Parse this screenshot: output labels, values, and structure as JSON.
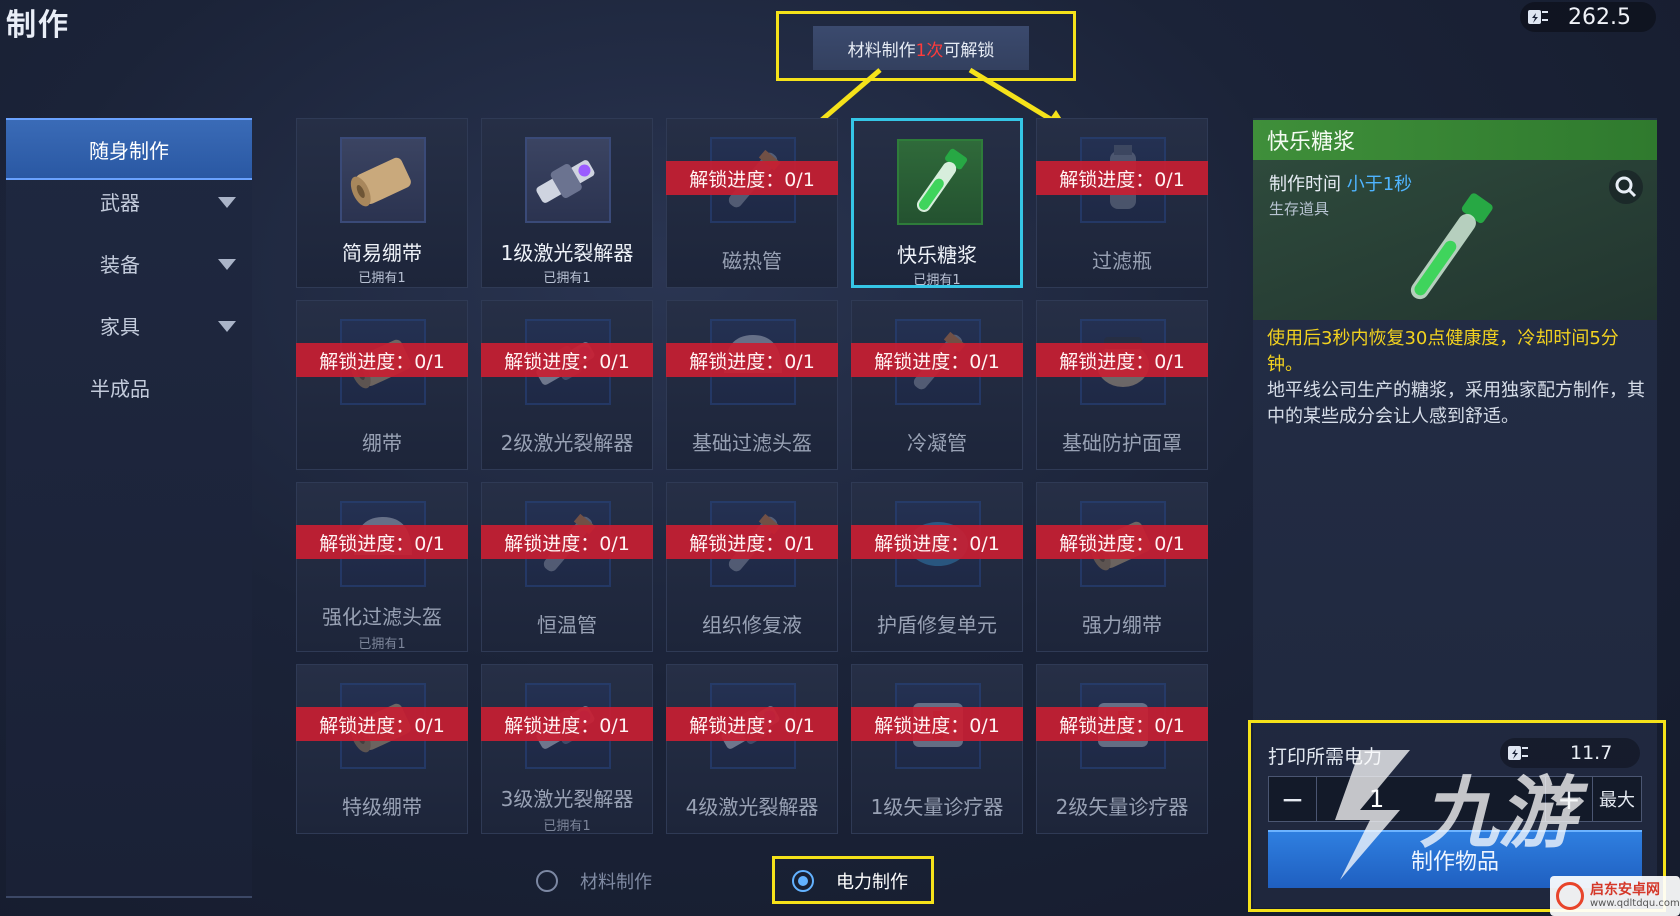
{
  "title": "制作",
  "top_power": {
    "value": "262.5",
    "icon": "power-plug-icon"
  },
  "hint": {
    "pre": "材料制作",
    "count": "1次",
    "post": "可解锁"
  },
  "sidebar": {
    "items": [
      {
        "label": "随身制作",
        "active": true
      },
      {
        "label": "武器",
        "dropdown": true
      },
      {
        "label": "装备",
        "dropdown": true
      },
      {
        "label": "家具",
        "dropdown": true
      },
      {
        "label": "半成品"
      }
    ]
  },
  "grid": {
    "items": [
      {
        "name": "简易绷带",
        "owned": "已拥有1",
        "locked": false,
        "art": "bandage"
      },
      {
        "name": "1级激光裂解器",
        "owned": "已拥有1",
        "locked": false,
        "art": "laser"
      },
      {
        "name": "磁热管",
        "progress": "解锁进度：0/1",
        "locked": true,
        "art": "tube"
      },
      {
        "name": "快乐糖浆",
        "owned": "已拥有1",
        "locked": false,
        "selected": true,
        "art": "syrup"
      },
      {
        "name": "过滤瓶",
        "progress": "解锁进度：0/1",
        "locked": true,
        "art": "bottle"
      },
      {
        "name": "绷带",
        "progress": "解锁进度：0/1",
        "locked": true,
        "art": "bandage"
      },
      {
        "name": "2级激光裂解器",
        "progress": "解锁进度：0/1",
        "locked": true,
        "art": "laser"
      },
      {
        "name": "基础过滤头盔",
        "progress": "解锁进度：0/1",
        "locked": true,
        "art": "helmet"
      },
      {
        "name": "冷凝管",
        "progress": "解锁进度：0/1",
        "locked": true,
        "art": "tube"
      },
      {
        "name": "基础防护面罩",
        "progress": "解锁进度：0/1",
        "locked": true,
        "art": "mask"
      },
      {
        "name": "强化过滤头盔",
        "progress": "解锁进度：0/1",
        "owned": "已拥有1",
        "locked": true,
        "art": "helmet"
      },
      {
        "name": "恒温管",
        "progress": "解锁进度：0/1",
        "locked": true,
        "art": "tube"
      },
      {
        "name": "组织修复液",
        "progress": "解锁进度：0/1",
        "locked": true,
        "art": "tube"
      },
      {
        "name": "护盾修复单元",
        "progress": "解锁进度：0/1",
        "locked": true,
        "art": "shield"
      },
      {
        "name": "强力绷带",
        "progress": "解锁进度：0/1",
        "locked": true,
        "art": "bandage"
      },
      {
        "name": "特级绷带",
        "progress": "解锁进度：0/1",
        "locked": true,
        "art": "bandage"
      },
      {
        "name": "3级激光裂解器",
        "progress": "解锁进度：0/1",
        "owned": "已拥有1",
        "locked": true,
        "art": "laser"
      },
      {
        "name": "4级激光裂解器",
        "progress": "解锁进度：0/1",
        "locked": true,
        "art": "laser"
      },
      {
        "name": "1级矢量诊疗器",
        "progress": "解锁进度：0/1",
        "locked": true,
        "art": "medkit"
      },
      {
        "name": "2级矢量诊疗器",
        "progress": "解锁进度：0/1",
        "locked": true,
        "art": "medkit"
      }
    ]
  },
  "detail": {
    "name": "快乐糖浆",
    "time_label": "制作时间",
    "time_value": "小于1秒",
    "category": "生存道具",
    "effect": "使用后3秒内恢复30点健康度，冷却时间5分钟。",
    "lore": "地平线公司生产的糖浆，采用独家配方制作，其中的某些成分会让人感到舒适。"
  },
  "craft": {
    "power_label": "打印所需电力",
    "power_value": "11.7",
    "minus": "−",
    "quantity": "1",
    "plus": "+",
    "max": "最大",
    "button": "制作物品"
  },
  "modes": {
    "material": "材料制作",
    "power": "电力制作"
  },
  "watermark": {
    "brand": "九游",
    "site_title": "启东安卓网",
    "site_url": "www.qdltdqu.com"
  },
  "colors": {
    "accent_blue": "#2f7fe0",
    "selected_border": "#35c6e6",
    "locked_ribbon": "#c81e32",
    "highlight_yellow": "#f5e21a",
    "effect_text": "#f2d21f",
    "header_green": "#3f8f3a"
  }
}
